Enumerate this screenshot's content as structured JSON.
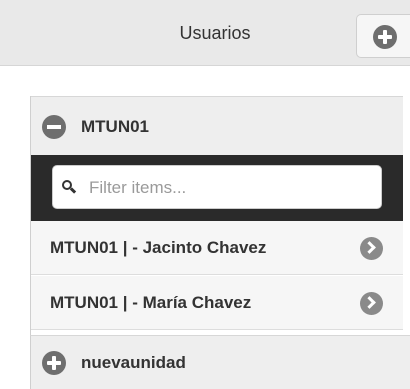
{
  "header": {
    "title": "Usuarios",
    "add_icon": "plus-circle-icon"
  },
  "units": [
    {
      "name": "MTUN01",
      "expanded": true,
      "toggle_icon": "minus-circle-icon",
      "filter": {
        "placeholder": "Filter items...",
        "value": ""
      },
      "items": [
        {
          "label": "MTUN01 | - Jacinto Chavez",
          "icon": "chevron-right-circle-icon"
        },
        {
          "label": "MTUN01 | - María Chavez",
          "icon": "chevron-right-circle-icon"
        }
      ]
    },
    {
      "name": "nuevaunidad",
      "expanded": false,
      "toggle_icon": "plus-circle-icon"
    }
  ],
  "colors": {
    "header_bg": "#e9e9e9",
    "filter_bar_bg": "#2a2a2a",
    "icon_fill": "#6e6e6e"
  }
}
